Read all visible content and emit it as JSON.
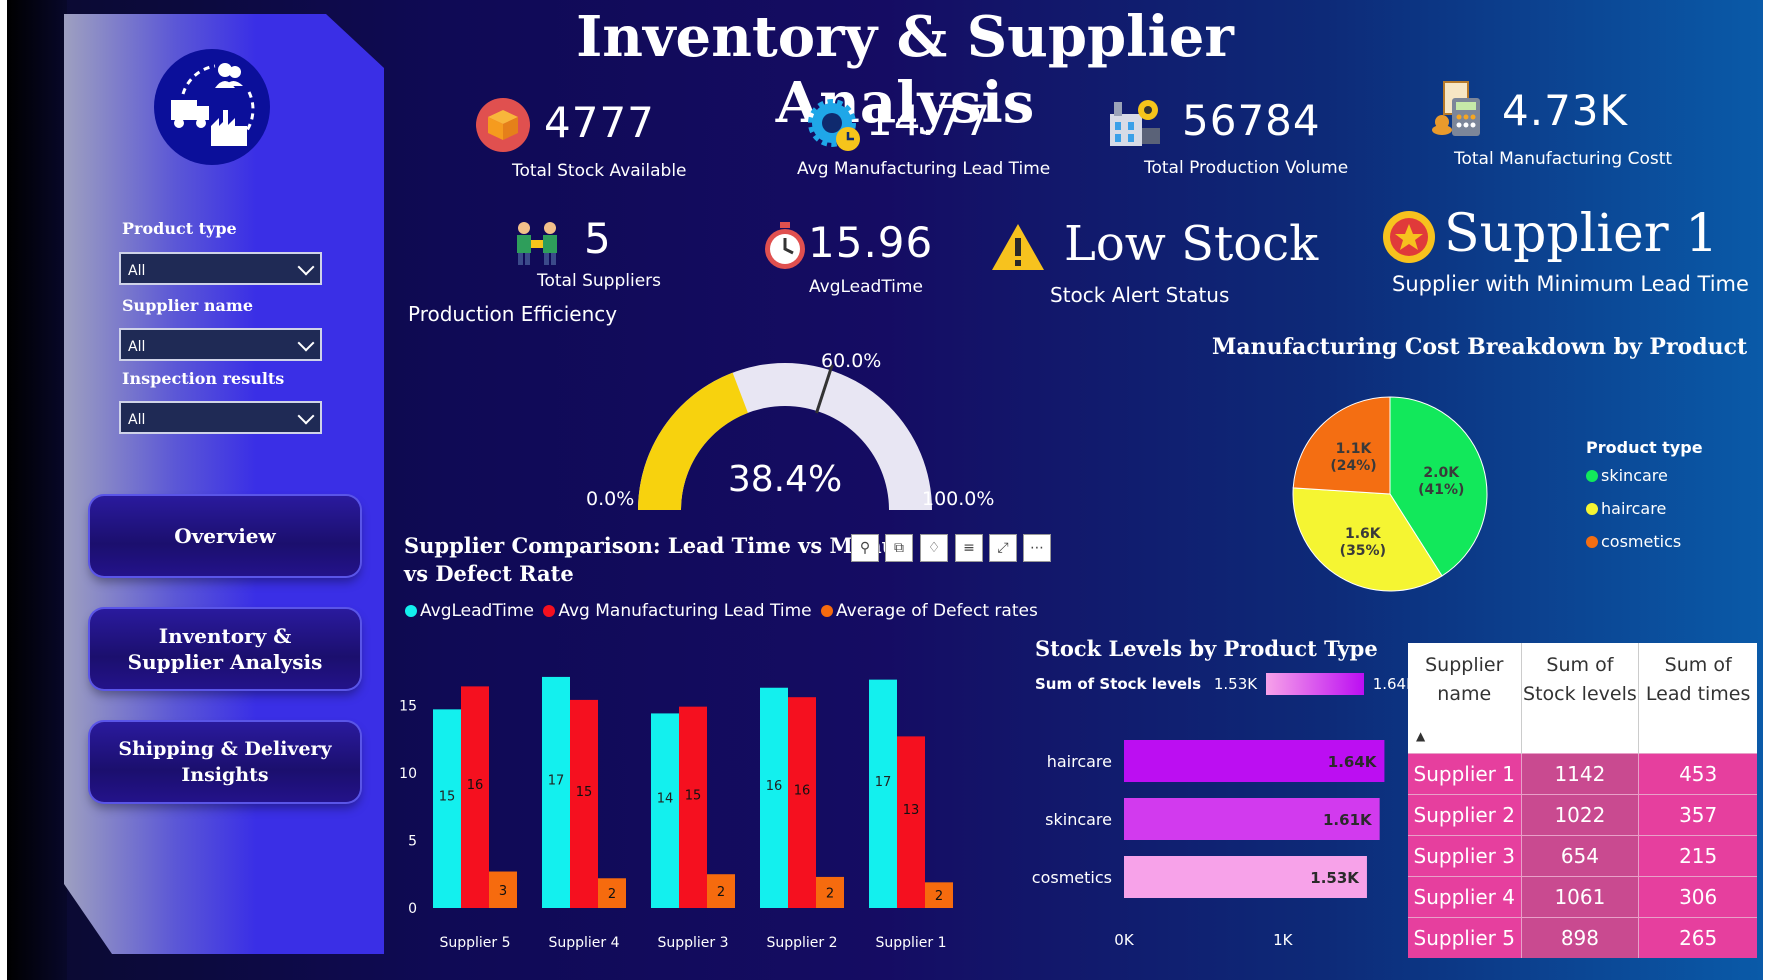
{
  "page": {
    "title": "Inventory & Supplier Analysis"
  },
  "sidebar": {
    "logo_icon": "supply-chain-logo-icon",
    "filters": [
      {
        "label": "Product type",
        "value": "All"
      },
      {
        "label": "Supplier name",
        "value": "All"
      },
      {
        "label": "Inspection results",
        "value": "All"
      }
    ],
    "nav": [
      {
        "label": "Overview"
      },
      {
        "label": "Inventory & Supplier Analysis"
      },
      {
        "label": "Shipping & Delivery Insights"
      }
    ]
  },
  "kpis": {
    "total_stock": {
      "value": "4777",
      "label": "Total Stock Available",
      "icon": "box-icon"
    },
    "avg_mfg_lead": {
      "value": "14.77",
      "label": "Avg Manufacturing Lead Time",
      "icon": "gear-clock-icon"
    },
    "production_volume": {
      "value": "56784",
      "label": "Total Production Volume",
      "icon": "factory-icon"
    },
    "mfg_cost": {
      "value": "4.73K",
      "label": "Total Manufacturing Costt",
      "icon": "cost-calculator-icon"
    },
    "total_suppliers": {
      "value": "5",
      "label": "Total Suppliers",
      "icon": "suppliers-icon"
    },
    "avg_lead_time": {
      "value": "15.96",
      "label": "AvgLeadTime",
      "icon": "stopwatch-icon"
    },
    "stock_alert": {
      "value": "Low Stock",
      "label": "Stock Alert Status",
      "icon": "warning-icon"
    },
    "min_lead_supplier": {
      "value": "Supplier 1",
      "label": "Supplier with Minimum Lead Time",
      "icon": "medal-icon"
    }
  },
  "gauge": {
    "title": "Production Efficiency",
    "value_label": "38.4%",
    "min_label": "0.0%",
    "max_label": "100.0%",
    "target_label": "60.0%",
    "value": 0.384,
    "target": 0.6,
    "colors": {
      "fill": "#f7d20e",
      "track": "#e8e6f3",
      "needle": "#333333"
    }
  },
  "bar_chart": {
    "title_line1": "Supplier Comparison: Lead Time vs Manuf",
    "title_line2": "vs Defect Rate",
    "toolbar_icons": [
      "pin-icon",
      "copy-icon",
      "bell-icon",
      "filter-icon",
      "expand-icon",
      "more-icon"
    ]
  },
  "pie_chart": {
    "title": "Manufacturing Cost Breakdown by Product",
    "legend_title": "Product type"
  },
  "stock_chart": {
    "title": "Stock Levels by Product Type",
    "legend_label": "Sum of Stock levels",
    "legend_min": "1.53K",
    "legend_max": "1.64K"
  },
  "table": {
    "columns": [
      "Supplier name",
      "Sum of Stock levels",
      "Sum of Lead times"
    ],
    "rows": [
      [
        "Supplier 1",
        "1142",
        "453"
      ],
      [
        "Supplier 2",
        "1022",
        "357"
      ],
      [
        "Supplier 3",
        "654",
        "215"
      ],
      [
        "Supplier 4",
        "1061",
        "306"
      ],
      [
        "Supplier 5",
        "898",
        "265"
      ]
    ],
    "colors": {
      "row": "#e63f9e",
      "highlight": "#c94a90"
    }
  },
  "chart_data": [
    {
      "type": "bar",
      "title": "Supplier Comparison: Lead Time vs Manuf vs Defect Rate",
      "categories": [
        "Supplier 5",
        "Supplier 4",
        "Supplier 3",
        "Supplier 2",
        "Supplier 1"
      ],
      "series": [
        {
          "name": "AvgLeadTime",
          "color": "#13f0ee",
          "values": [
            14.7,
            17.1,
            14.4,
            16.3,
            16.9
          ],
          "labels": [
            "15",
            "17",
            "14",
            "16",
            "17"
          ]
        },
        {
          "name": "Avg Manufacturing Lead Time",
          "color": "#f5101f",
          "values": [
            16.4,
            15.4,
            14.9,
            15.6,
            12.7
          ],
          "labels": [
            "16",
            "15",
            "15",
            "16",
            "13"
          ]
        },
        {
          "name": "Average of Defect rates",
          "color": "#f66b0e",
          "values": [
            2.7,
            2.2,
            2.5,
            2.3,
            1.9
          ],
          "labels": [
            "3",
            "2",
            "2",
            "2",
            "2"
          ]
        }
      ],
      "yticks": [
        0,
        5,
        10,
        15
      ],
      "ylim": [
        0,
        18.5
      ],
      "legend": "top-left"
    },
    {
      "type": "pie",
      "title": "Manufacturing Cost Breakdown by Product",
      "legend_title": "Product type",
      "slices": [
        {
          "name": "skincare",
          "value": 2.0,
          "pct": 41,
          "label": "2.0K",
          "pct_label": "(41%)",
          "color": "#12e85b"
        },
        {
          "name": "haircare",
          "value": 1.6,
          "pct": 35,
          "label": "1.6K",
          "pct_label": "(35%)",
          "color": "#f5f532"
        },
        {
          "name": "cosmetics",
          "value": 1.1,
          "pct": 24,
          "label": "1.1K",
          "pct_label": "(24%)",
          "color": "#f46e12"
        }
      ],
      "legend": "right"
    },
    {
      "type": "bar",
      "orientation": "horizontal",
      "title": "Stock Levels by Product Type",
      "categories": [
        "haircare",
        "skincare",
        "cosmetics"
      ],
      "values": [
        1640,
        1610,
        1530
      ],
      "labels": [
        "1.64K",
        "1.61K",
        "1.53K"
      ],
      "colors": [
        "#bc0ef2",
        "#d23aee",
        "#f7a2e9"
      ],
      "xticks": [
        "0K",
        "1K"
      ],
      "xlim": [
        0,
        1650
      ]
    }
  ]
}
